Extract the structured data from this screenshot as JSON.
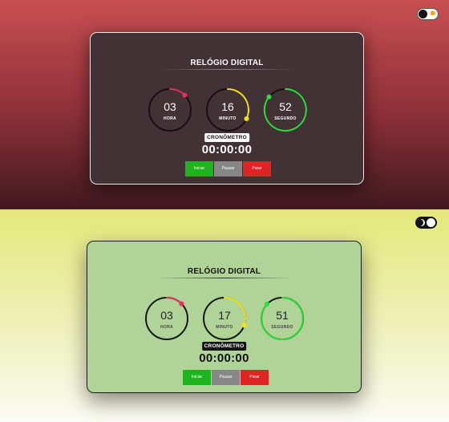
{
  "theme_toggle_dark": {
    "icon": "sun-icon"
  },
  "theme_toggle_light": {
    "icon": "moon-icon"
  },
  "cards": [
    {
      "theme": "dark",
      "title": "RELÓGIO DIGITAL",
      "hour": {
        "value": "03",
        "label": "HORA",
        "color": "#e3305f"
      },
      "minute": {
        "value": "16",
        "label": "MINUTO",
        "color": "#f2e21a"
      },
      "second": {
        "value": "52",
        "label": "SEGUNDO",
        "color": "#29e03a"
      },
      "stopwatch_label": "CRONÔMETRO",
      "stopwatch_time": "00:00:00",
      "buttons": {
        "start": "Iniciar",
        "pause": "Pausar",
        "stop": "Parar"
      }
    },
    {
      "theme": "light",
      "title": "RELÓGIO DIGITAL",
      "hour": {
        "value": "03",
        "label": "HORA",
        "color": "#e3305f"
      },
      "minute": {
        "value": "17",
        "label": "MINUTO",
        "color": "#f2e21a"
      },
      "second": {
        "value": "51",
        "label": "SEGUNDO",
        "color": "#29e03a"
      },
      "stopwatch_label": "CRONÔMETRO",
      "stopwatch_time": "00:00:00",
      "buttons": {
        "start": "Iniciar",
        "pause": "Pausar",
        "stop": "Parar"
      }
    }
  ]
}
